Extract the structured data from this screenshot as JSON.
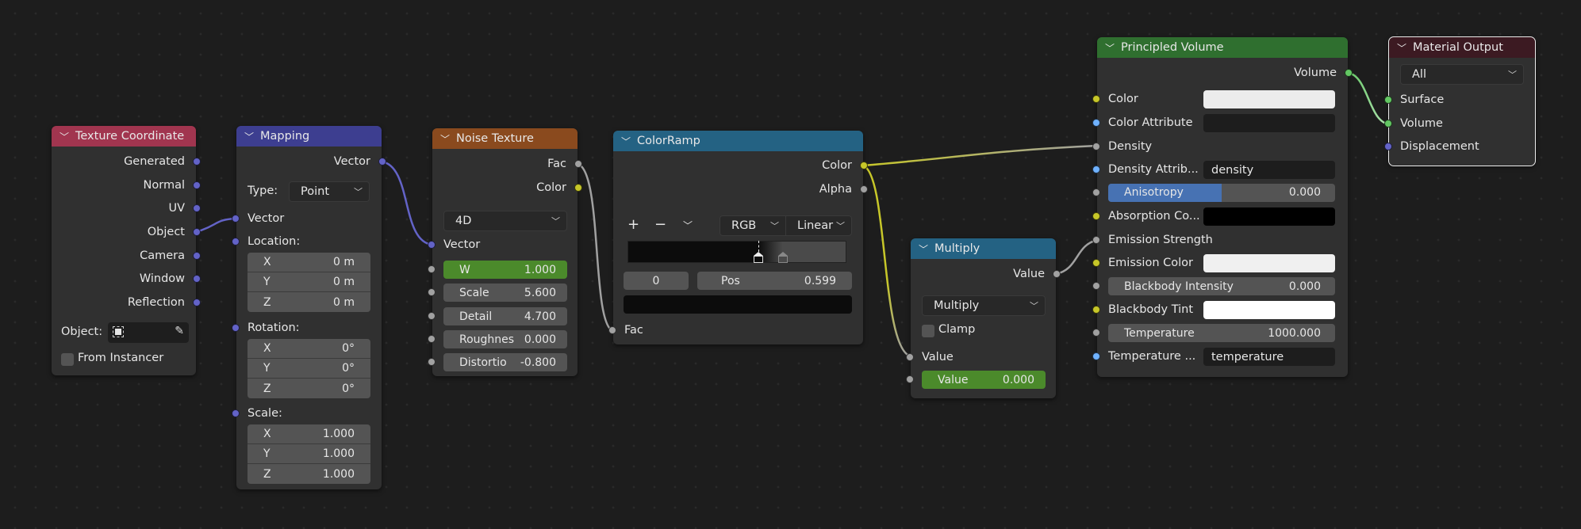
{
  "editor": "Shader Node Editor",
  "colors": {
    "background": "#1d1d1d",
    "node_body": "#303030",
    "field": "#545454",
    "field_active_green": "#4b8a2b",
    "anisotropy_fill": "#4772b3",
    "socket_vector": "#6363c7",
    "socket_float": "#a1a1a1",
    "socket_color": "#c7c729",
    "socket_shader": "#63c763",
    "socket_string": "#70b2ff"
  },
  "nodes": {
    "texture_coordinate": {
      "title": "Texture Coordinate",
      "header_color": "#a1354f",
      "outputs": [
        "Generated",
        "Normal",
        "UV",
        "Object",
        "Camera",
        "Window",
        "Reflection"
      ],
      "object_label": "Object:",
      "object_value": "",
      "from_instancer_label": "From Instancer",
      "from_instancer_checked": false
    },
    "mapping": {
      "title": "Mapping",
      "header_color": "#3d3e90",
      "output": "Vector",
      "type_label": "Type:",
      "type_value": "Point",
      "vector_input": "Vector",
      "location_label": "Location:",
      "location": [
        {
          "axis": "X",
          "value": "0 m"
        },
        {
          "axis": "Y",
          "value": "0 m"
        },
        {
          "axis": "Z",
          "value": "0 m"
        }
      ],
      "rotation_label": "Rotation:",
      "rotation": [
        {
          "axis": "X",
          "value": "0°"
        },
        {
          "axis": "Y",
          "value": "0°"
        },
        {
          "axis": "Z",
          "value": "0°"
        }
      ],
      "scale_label": "Scale:",
      "scale": [
        {
          "axis": "X",
          "value": "1.000"
        },
        {
          "axis": "Y",
          "value": "1.000"
        },
        {
          "axis": "Z",
          "value": "1.000"
        }
      ]
    },
    "noise_texture": {
      "title": "Noise Texture",
      "header_color": "#8a4a1e",
      "outputs": [
        "Fac",
        "Color"
      ],
      "dimensions": "4D",
      "vector_input": "Vector",
      "fields": [
        {
          "label": "W",
          "value": "1.000",
          "active": true
        },
        {
          "label": "Scale",
          "value": "5.600"
        },
        {
          "label": "Detail",
          "value": "4.700"
        },
        {
          "label": "Roughnes",
          "value": "0.000"
        },
        {
          "label": "Distortio",
          "value": "-0.800"
        }
      ]
    },
    "color_ramp": {
      "title": "ColorRamp",
      "header_color": "#246283",
      "outputs": [
        "Color",
        "Alpha"
      ],
      "add_label": "+",
      "remove_label": "−",
      "menu_label": "⌄",
      "color_mode": "RGB",
      "interpolation": "Linear",
      "stops": [
        {
          "position": 0.599,
          "color": "#0c0c0c",
          "active": true
        },
        {
          "position": 0.71,
          "color": "#4a4a4a",
          "active": false
        }
      ],
      "active_index": "0",
      "pos_label": "Pos",
      "pos_value": "0.599",
      "active_color": "#0c0c0c",
      "input": "Fac"
    },
    "multiply": {
      "title": "Multiply",
      "header_color": "#246283",
      "output": "Value",
      "operation": "Multiply",
      "clamp_label": "Clamp",
      "clamp_checked": false,
      "input_value_label": "Value",
      "value_field_label": "Value",
      "value_field_value": "0.000"
    },
    "principled_volume": {
      "title": "Principled Volume",
      "header_color": "#2f6f2f",
      "output": "Volume",
      "color_label": "Color",
      "color_value": "#ececec",
      "color_attribute_label": "Color Attribute",
      "color_attribute_value": "",
      "density_label": "Density",
      "density_attribute_label": "Density Attrib...",
      "density_attribute_value": "density",
      "anisotropy_label": "Anisotropy",
      "anisotropy_value": "0.000",
      "anisotropy_fill_fraction": 0.5,
      "absorption_label": "Absorption Co...",
      "absorption_value": "#000000",
      "emission_strength_label": "Emission Strength",
      "emission_color_label": "Emission Color",
      "emission_color_value": "#f0f0f0",
      "blackbody_intensity_label": "Blackbody Intensity",
      "blackbody_intensity_value": "0.000",
      "blackbody_tint_label": "Blackbody Tint",
      "blackbody_tint_value": "#ffffff",
      "temperature_label": "Temperature",
      "temperature_value": "1000.000",
      "temperature_attribute_label": "Temperature ...",
      "temperature_attribute_value": "temperature"
    },
    "material_output": {
      "title": "Material Output",
      "header_color": "#3c1a22",
      "target": "All",
      "inputs": [
        "Surface",
        "Volume",
        "Displacement"
      ]
    }
  }
}
